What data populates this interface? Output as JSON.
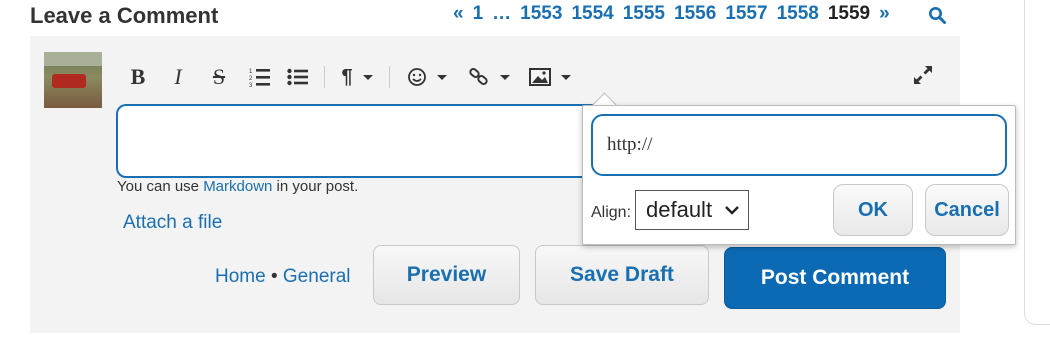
{
  "heading": "Leave a Comment",
  "pagination": {
    "prev": "«",
    "first": "1",
    "ellipsis": "…",
    "pages": [
      "1553",
      "1554",
      "1555",
      "1556",
      "1557",
      "1558"
    ],
    "current": "1559",
    "next": "»"
  },
  "toolbar": {
    "bold": "B",
    "italic": "I",
    "strike": "S",
    "paragraph": "¶"
  },
  "help": {
    "prefix": "You can use ",
    "link": "Markdown",
    "suffix": " in your post."
  },
  "attach_label": "Attach a file",
  "breadcrumb": {
    "home": "Home",
    "sep": "•",
    "category": "General"
  },
  "buttons": {
    "preview": "Preview",
    "save_draft": "Save Draft",
    "post": "Post Comment"
  },
  "image_popup": {
    "url_value": "http://",
    "align_label": "Align:",
    "align_value": "default",
    "ok": "OK",
    "cancel": "Cancel"
  },
  "colors": {
    "link": "#1a6fb0",
    "primary": "#0c6ab4",
    "panel": "#f3f3f3"
  },
  "icons": [
    "search-icon",
    "bold-icon",
    "italic-icon",
    "strikethrough-icon",
    "ordered-list-icon",
    "unordered-list-icon",
    "paragraph-icon",
    "emoji-icon",
    "link-icon",
    "image-icon",
    "expand-icon"
  ]
}
